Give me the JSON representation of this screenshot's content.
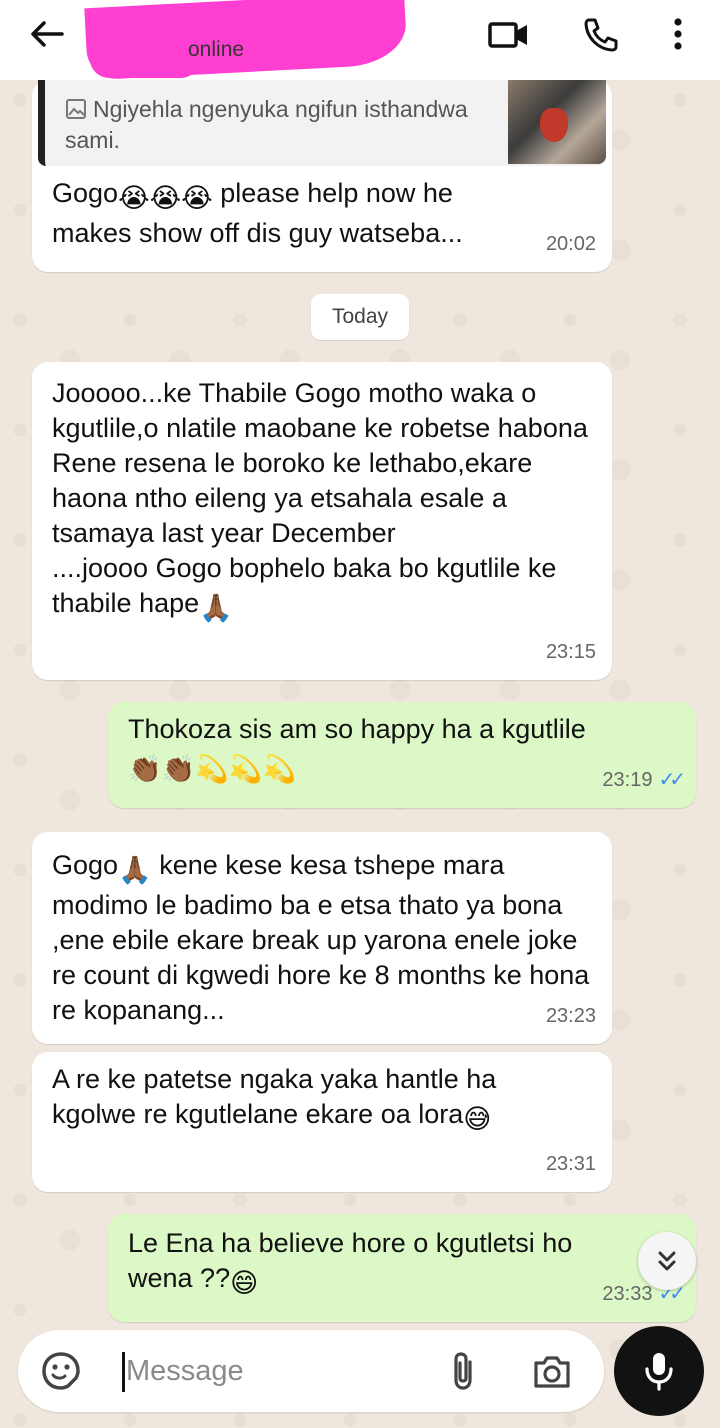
{
  "header": {
    "status": "online",
    "icons": [
      "back-arrow-icon",
      "video-call-icon",
      "voice-call-icon",
      "more-options-icon"
    ]
  },
  "messages": [
    {
      "direction": "in",
      "quote": {
        "text": "Ngiyehla ngenyuka ngifun isthandwa sami.",
        "thumb": "image-thumbnail"
      },
      "text_before": "Gogo",
      "emoji_1": "😭😭😭",
      "text_after": " please help now he makes show off dis guy watseba...",
      "time": "20:02"
    },
    {
      "divider": "Today"
    },
    {
      "direction": "in",
      "text": "Jooooo...ke Thabile Gogo motho waka o kgutlile,o nlatile maobane ke robetse habona Rene resena le boroko ke lethabo,ekare haona ntho eileng ya etsahala esale a tsamaya last year December\n....joooo Gogo bophelo baka bo kgutlile ke thabile hape",
      "emoji": "🙏🏾",
      "time": "23:15"
    },
    {
      "direction": "out",
      "text": "Thokoza sis am so happy  ha a kgutlile",
      "emoji": "👏🏾👏🏾💫💫💫",
      "time": "23:19",
      "status": "read"
    },
    {
      "direction": "in",
      "text_before": "Gogo",
      "emoji": "🙏🏾",
      "text_after": " kene kese kesa tshepe mara modimo le badimo ba e etsa thato ya bona ,ene ebile ekare break up yarona enele joke re count di kgwedi hore ke 8 months  ke hona re kopanang...",
      "time": "23:23"
    },
    {
      "direction": "in",
      "text": "A re ke patetse ngaka yaka hantle ha kgolwe re kgutlelane ekare oa lora",
      "emoji": "😅",
      "time": "23:31"
    },
    {
      "direction": "out",
      "text": "Le Ena ha believe hore o kgutletsi ho wena ??",
      "emoji": "😄",
      "time": "23:33",
      "status": "read"
    }
  ],
  "composer": {
    "placeholder": "Message",
    "icons": [
      "emoji-icon",
      "attach-icon",
      "camera-icon",
      "mic-icon"
    ]
  },
  "ticks": "✓✓",
  "colors": {
    "incoming_bubble": "#ffffff",
    "outgoing_bubble": "#dcf8c6",
    "read_ticks": "#3d8ef0",
    "background": "#efe7dd",
    "redaction": "#ff3fd2"
  }
}
